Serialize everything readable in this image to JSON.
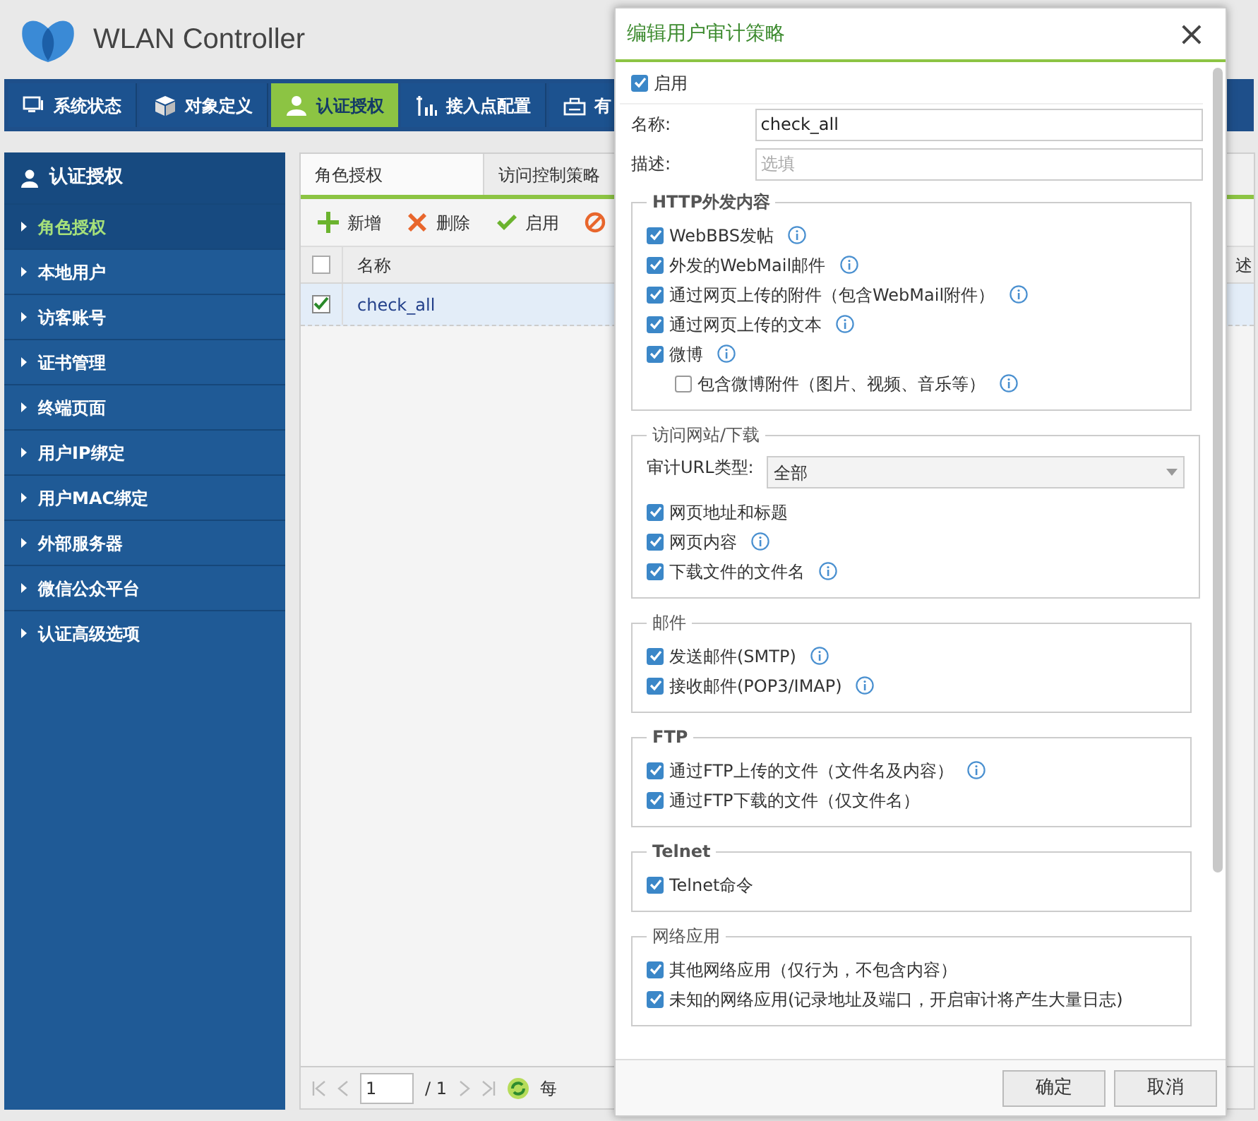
{
  "header": {
    "title": "WLAN Controller"
  },
  "nav": [
    {
      "label": "系统状态",
      "kind": "monitor",
      "selected": false
    },
    {
      "label": "对象定义",
      "kind": "cube",
      "selected": false
    },
    {
      "label": "认证授权",
      "kind": "user",
      "selected": true
    },
    {
      "label": "接入点配置",
      "kind": "antenna",
      "selected": false
    },
    {
      "label": "有",
      "kind": "router",
      "selected": false
    }
  ],
  "sidebar": {
    "title": "认证授权",
    "items": [
      {
        "label": "角色授权",
        "selected": true
      },
      {
        "label": "本地用户",
        "selected": false
      },
      {
        "label": "访客账号",
        "selected": false
      },
      {
        "label": "证书管理",
        "selected": false
      },
      {
        "label": "终端页面",
        "selected": false
      },
      {
        "label": "用户IP绑定",
        "selected": false
      },
      {
        "label": "用户MAC绑定",
        "selected": false
      },
      {
        "label": "外部服务器",
        "selected": false
      },
      {
        "label": "微信公众平台",
        "selected": false
      },
      {
        "label": "认证高级选项",
        "selected": false
      }
    ]
  },
  "tabs": [
    {
      "label": "角色授权",
      "selected": true
    },
    {
      "label": "访问控制策略",
      "selected": false
    }
  ],
  "toolbar": [
    {
      "kind": "add",
      "label": "新增"
    },
    {
      "kind": "delete",
      "label": "删除"
    },
    {
      "kind": "enable",
      "label": "启用"
    },
    {
      "kind": "disable"
    }
  ],
  "table": {
    "header_checked": false,
    "columns": [
      {
        "label": "名称"
      },
      {
        "label": "述"
      }
    ],
    "rows": [
      {
        "name": "check_all",
        "checked": true,
        "selected": true
      }
    ]
  },
  "pager": {
    "page": "1",
    "total": "/ 1",
    "per_page": "每"
  },
  "dialog": {
    "title": "编辑用户审计策略",
    "close": "×",
    "enabled": {
      "label": "启用",
      "checked": true
    },
    "name": {
      "label": "名称:",
      "value": "check_all"
    },
    "description": {
      "label": "描述:",
      "placeholder": "选填"
    },
    "sections": [
      {
        "title": "HTTP外发内容",
        "bold": true,
        "items": [
          {
            "label": "WebBBS发帖",
            "checked": true,
            "info": true
          },
          {
            "label": "外发的WebMail邮件",
            "checked": true,
            "info": true
          },
          {
            "label": "通过网页上传的附件（包含WebMail附件）",
            "checked": true,
            "info": true
          },
          {
            "label": "通过网页上传的文本",
            "checked": true,
            "info": true
          },
          {
            "label": "微博",
            "checked": true,
            "info": true,
            "children": [
              {
                "label": "包含微博附件（图片、视频、音乐等）",
                "checked": false,
                "info": true
              }
            ]
          }
        ]
      },
      {
        "title": "访问网站/下载",
        "bold": false,
        "select": {
          "label": "审计URL类型:",
          "value": "全部"
        },
        "items": [
          {
            "label": "网页地址和标题",
            "checked": true,
            "info": false
          },
          {
            "label": "网页内容",
            "checked": true,
            "info": true
          },
          {
            "label": "下载文件的文件名",
            "checked": true,
            "info": true
          }
        ]
      },
      {
        "title": "邮件",
        "bold": false,
        "items": [
          {
            "label": "发送邮件(SMTP)",
            "checked": true,
            "info": true
          },
          {
            "label": "接收邮件(POP3/IMAP)",
            "checked": true,
            "info": true
          }
        ]
      },
      {
        "title": "FTP",
        "bold": true,
        "items": [
          {
            "label": "通过FTP上传的文件（文件名及内容）",
            "checked": true,
            "info": true
          },
          {
            "label": "通过FTP下载的文件（仅文件名）",
            "checked": true,
            "info": false
          }
        ]
      },
      {
        "title": "Telnet",
        "bold": true,
        "items": [
          {
            "label": "Telnet命令",
            "checked": true,
            "info": false
          }
        ]
      },
      {
        "title": "网络应用",
        "bold": false,
        "items": [
          {
            "label": "其他网络应用（仅行为，不包含内容）",
            "checked": true,
            "info": false
          },
          {
            "label": "未知的网络应用(记录地址及端口，开启审计将产生大量日志)",
            "checked": true,
            "info": false
          }
        ]
      }
    ],
    "buttons": [
      {
        "label": "确定"
      },
      {
        "label": "取消"
      }
    ]
  }
}
